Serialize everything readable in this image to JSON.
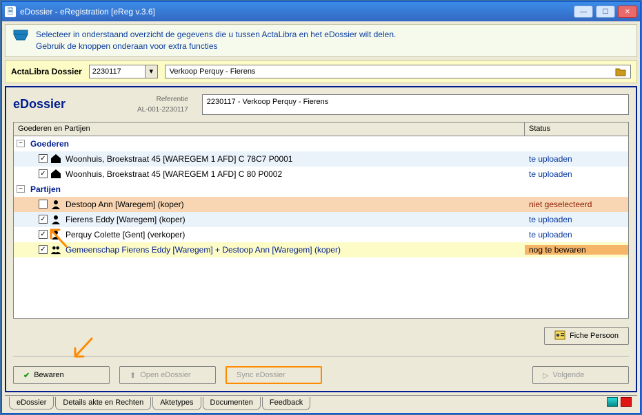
{
  "window": {
    "title": "eDossier - eRegistration [eReg v.3.6]"
  },
  "info": {
    "line1": "Selecteer in onderstaand overzicht de gegevens die u tussen ActaLibra en het eDossier wilt delen.",
    "line2": "Gebruik de knoppen onderaan voor extra functies"
  },
  "dossier_bar": {
    "label": "ActaLibra Dossier",
    "number": "2230117",
    "desc": "Verkoop Perquy - Fierens"
  },
  "panel": {
    "heading": "eDossier",
    "ref_label": "Referentie",
    "ref_code": "AL-001-2230117",
    "ref_value": "2230117 - Verkoop Perquy - Fierens"
  },
  "grid": {
    "columns": {
      "c1": "Goederen en Partijen",
      "c2": "Status"
    },
    "groups": [
      {
        "label": "Goederen",
        "items": [
          {
            "checked": true,
            "icon": "house",
            "text": "Woonhuis, Broekstraat 45 [WAREGEM  1 AFD] C 78C7 P0001",
            "status": "te uploaden",
            "style": "item"
          },
          {
            "checked": true,
            "icon": "house",
            "text": "Woonhuis, Broekstraat 45 [WAREGEM  1 AFD] C 80 P0002",
            "status": "te uploaden",
            "style": "item alt"
          }
        ]
      },
      {
        "label": "Partijen",
        "items": [
          {
            "checked": false,
            "icon": "person",
            "text": "Destoop Ann [Waregem] (koper)",
            "status": "niet geselecteerd",
            "style": "item warn ns"
          },
          {
            "checked": true,
            "icon": "person",
            "text": "Fierens Eddy [Waregem] (koper)",
            "status": "te uploaden",
            "style": "item"
          },
          {
            "checked": true,
            "icon": "person",
            "text": "Perquy Colette [Gent] (verkoper)",
            "status": "te uploaden",
            "style": "item alt"
          },
          {
            "checked": true,
            "icon": "people",
            "text": "Gemeenschap Fierens Eddy [Waregem] + Destoop Ann [Waregem] (koper)",
            "status": "nog te bewaren",
            "style": "item hl"
          }
        ]
      }
    ]
  },
  "buttons": {
    "fiche": "Fiche Persoon",
    "bewaren": "Bewaren",
    "open": "Open eDossier",
    "sync": "Sync eDossier",
    "volgende": "Volgende"
  },
  "tabs": [
    "eDossier",
    "Details akte en Rechten",
    "Aktetypes",
    "Documenten",
    "Feedback"
  ],
  "status_hl_col2_bg": "#f6b66a"
}
